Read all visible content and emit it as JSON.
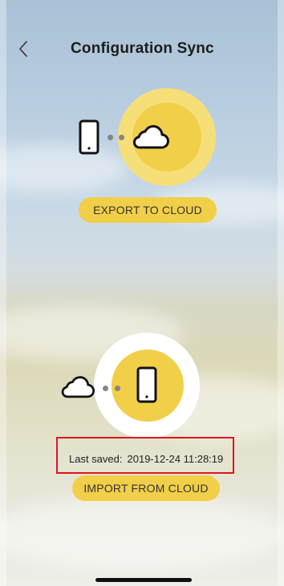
{
  "header": {
    "title": "Configuration Sync",
    "back_icon": "chevron-left-icon"
  },
  "export_section": {
    "source_icon": "phone-icon",
    "target_icon": "cloud-icon",
    "button_label": "EXPORT TO CLOUD"
  },
  "import_section": {
    "source_icon": "cloud-icon",
    "target_icon": "phone-icon",
    "last_saved_label": "Last saved:",
    "last_saved_value": "2019-12-24 11:28:19",
    "button_label": "IMPORT FROM CLOUD"
  },
  "colors": {
    "accent_yellow": "#f2cf49",
    "accent_yellow_light": "#f6df79",
    "highlight_red": "#e1151f"
  }
}
